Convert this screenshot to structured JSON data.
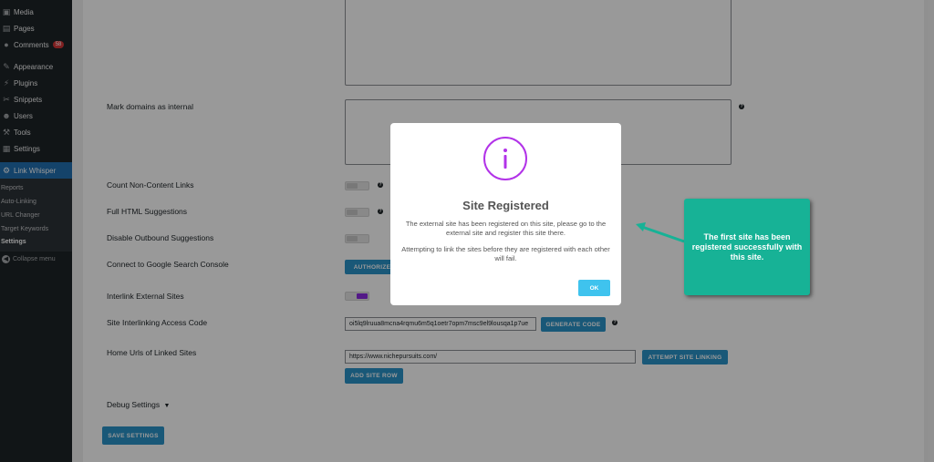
{
  "sidebar": {
    "items": [
      {
        "label": "Media",
        "icon": "media-icon"
      },
      {
        "label": "Pages",
        "icon": "pages-icon"
      },
      {
        "label": "Comments",
        "icon": "comments-icon",
        "badge": "58"
      },
      {
        "label": "Appearance",
        "icon": "appearance-icon"
      },
      {
        "label": "Plugins",
        "icon": "plugins-icon"
      },
      {
        "label": "Snippets",
        "icon": "snippets-icon"
      },
      {
        "label": "Users",
        "icon": "users-icon"
      },
      {
        "label": "Tools",
        "icon": "tools-icon"
      },
      {
        "label": "Settings",
        "icon": "settings-icon"
      },
      {
        "label": "Link Whisper",
        "icon": "link-whisper-icon"
      }
    ],
    "submenu": [
      "Reports",
      "Auto-Linking",
      "URL Changer",
      "Target Keywords",
      "Settings"
    ],
    "collapse_label": "Collapse menu"
  },
  "settings": {
    "mark_domains_label": "Mark domains as internal",
    "count_non_content_label": "Count Non-Content Links",
    "full_html_label": "Full HTML Suggestions",
    "disable_outbound_label": "Disable Outbound Suggestions",
    "gsc_label": "Connect to Google Search Console",
    "authorize_button": "AUTHORIZE",
    "interlink_external_label": "Interlink External Sites",
    "access_code_label": "Site Interlinking Access Code",
    "access_code_value": "oi5lq9lruua8mcna4rqmu6m5q1oetr7opm7msc9el9lousqa1p7ue",
    "generate_code_button": "GENERATE CODE",
    "home_urls_label": "Home Urls of Linked Sites",
    "home_url_value": "https://www.nichepursuits.com/",
    "attempt_linking_button": "ATTEMPT SITE LINKING",
    "add_site_row_button": "ADD SITE ROW",
    "debug_settings_label": "Debug Settings",
    "debug_arrow": "▼",
    "save_button": "SAVE SETTINGS",
    "help_glyph": "?"
  },
  "modal": {
    "title": "Site Registered",
    "text1": "The external site has been registered on this site, please go to the external site and register this site there.",
    "text2": "Attempting to link the sites before they are registered with each other will fail.",
    "ok_label": "OK"
  },
  "callout": {
    "text": "The first site has been registered successfully with this site."
  },
  "colors": {
    "sidebar_bg": "#1d2327",
    "active_blue": "#2271b1",
    "button_blue": "#2a93c8",
    "toggle_on": "#8a2be2",
    "modal_icon": "#b233e8",
    "ok_button": "#3fc3ee",
    "callout_bg": "#17b296"
  }
}
